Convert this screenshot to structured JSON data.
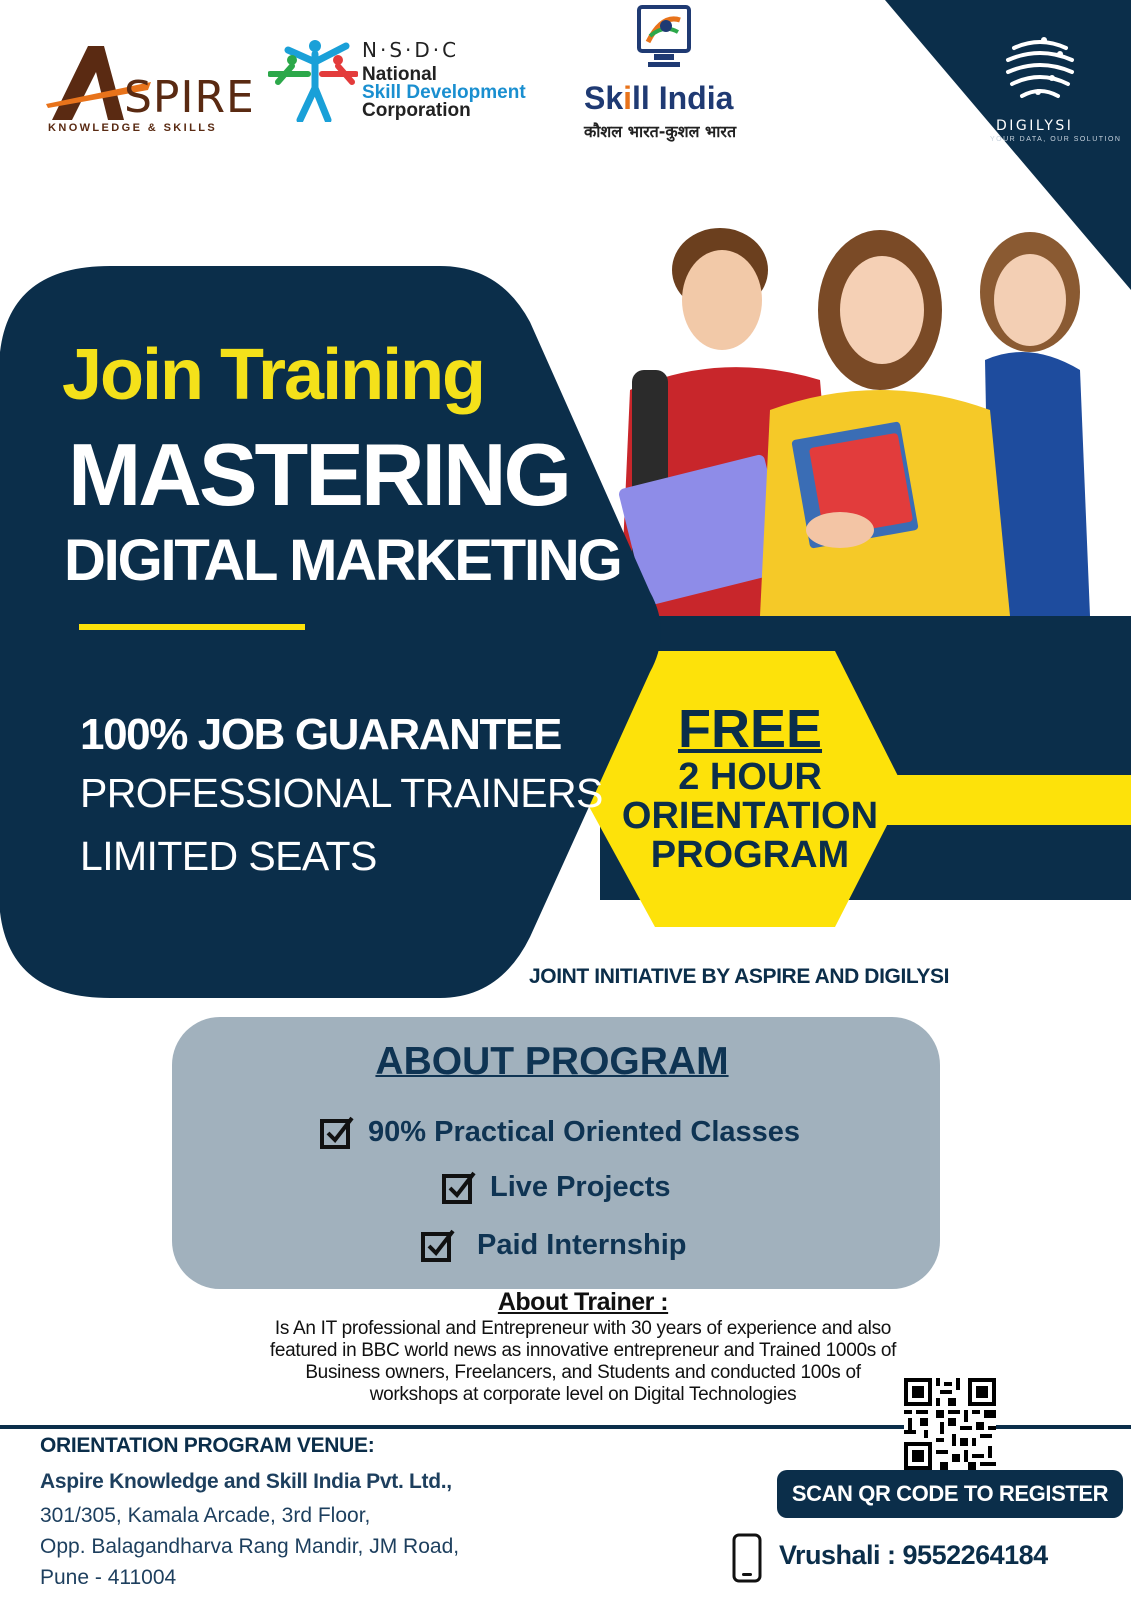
{
  "colors": {
    "navy": "#0b2e4a",
    "yellow": "#fde20a",
    "yellow_text": "#f4e11a",
    "panel_grey": "#a1b1bd",
    "brown": "#5a2a12",
    "orange": "#e8731b"
  },
  "logos": {
    "aspire": {
      "name": "SPIRE",
      "tagline": "KNOWLEDGE & SKILLS"
    },
    "nsdc": {
      "acronym": "N·S·D·C",
      "line1": "National",
      "line2": "Skill Development",
      "line3": "Corporation"
    },
    "skill_india": {
      "name_a": "Sk",
      "name_b": "ll India",
      "tagline": "कौशल भारत-कुशल भारत"
    },
    "digilysi": {
      "name": "DIGILYSI",
      "tagline": "YOUR DATA, OUR SOLUTION"
    }
  },
  "hero": {
    "kicker": "Join Training",
    "title_line1": "MASTERING",
    "title_line2": "DIGITAL MARKETING",
    "benefits": [
      "100% JOB GUARANTEE",
      "PROFESSIONAL TRAINERS",
      "LIMITED SEATS"
    ]
  },
  "badge": {
    "free": "FREE",
    "line1": "2 HOUR",
    "line2": "ORIENTATION",
    "line3": "PROGRAM"
  },
  "initiative": "JOINT INITIATIVE BY ASPIRE AND DIGILYSI",
  "about_program": {
    "heading": "ABOUT PROGRAM",
    "items": [
      "90% Practical Oriented Classes",
      "Live Projects",
      "Paid Internship"
    ]
  },
  "about_trainer": {
    "heading": "About Trainer :",
    "lines": [
      "Is An IT professional and Entrepreneur with 30 years of experience and also",
      "featured in BBC world news as innovative entrepreneur and Trained 1000s of",
      "Business owners, Freelancers, and Students and conducted 100s of",
      "workshops at corporate level on Digital Technologies"
    ]
  },
  "venue": {
    "heading": "ORIENTATION PROGRAM VENUE:",
    "company": "Aspire Knowledge and Skill India Pvt. Ltd.,",
    "address": [
      "301/305, Kamala Arcade, 3rd Floor,",
      "Opp. Balagandharva Rang Mandir, JM Road,",
      "Pune - 411004"
    ]
  },
  "register": {
    "button": "SCAN QR CODE TO REGISTER",
    "contact": "Vrushali : 9552264184"
  },
  "icons": [
    "checkbox-icon",
    "phone-icon",
    "qr-code",
    "skill-india-emblem-icon",
    "nsdc-figures-icon",
    "digilysi-mark-icon"
  ]
}
